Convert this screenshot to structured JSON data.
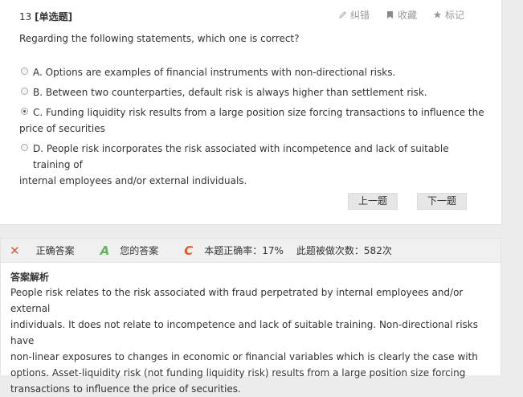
{
  "question": {
    "number": "13",
    "type_label": "[单选题]",
    "stem": "Regarding the following statements, which one is correct?",
    "options": [
      {
        "letter": "A",
        "text": "A. Options are examples of financial instruments with non-directional risks.",
        "selected": false
      },
      {
        "letter": "B",
        "text": "B. Between two counterparties, default risk is always higher than settlement risk.",
        "selected": false
      },
      {
        "letter": "C",
        "line1": "C. Funding liquidity risk results from a large position size forcing transactions to influence the",
        "line2": "price of securities",
        "selected": true
      },
      {
        "letter": "D",
        "line1": "D. People risk incorporates the risk associated with incompetence and lack of suitable training of",
        "line2": "internal employees and/or external individuals.",
        "selected": false
      }
    ]
  },
  "tools": {
    "report_error": "纠错",
    "favorite": "收藏",
    "mark": "标记"
  },
  "nav": {
    "prev": "上一题",
    "next": "下一题"
  },
  "answer_bar": {
    "correct_mark": "✕",
    "correct_label": "正确答案",
    "correct_answer": "A",
    "your_label": "您的答案",
    "your_answer": "C",
    "accuracy_text": "本题正确率：17%",
    "count_text": "此题被做次数：582次"
  },
  "explanation": {
    "title": "答案解析",
    "lines": [
      "People risk relates to the risk associated with fraud perpetrated by internal employees and/or external",
      "individuals. It does not relate to incompetence and lack of suitable training. Non-directional risks have",
      "non-linear exposures to changes in economic or financial variables which is clearly the case with",
      "options. Asset-liquidity risk (not funding liquidity risk) results from a large position size forcing",
      "transactions to influence the price of securities."
    ]
  },
  "colors": {
    "wrong_red": "#e4572e",
    "answer_green": "#5cb85c",
    "muted_gray": "#999999"
  }
}
